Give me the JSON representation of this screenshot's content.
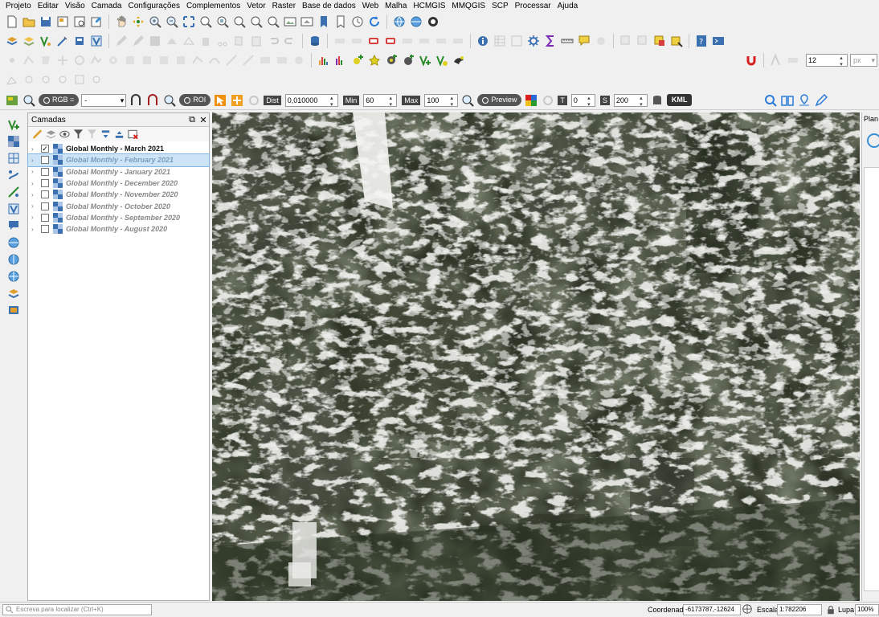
{
  "menubar": {
    "items": [
      "Projeto",
      "Editar",
      "Visão",
      "Camada",
      "Configurações",
      "Complementos",
      "Vetor",
      "Raster",
      "Base de dados",
      "Web",
      "Malha",
      "HCMGIS",
      "MMQGIS",
      "SCP",
      "Processar",
      "Ajuda"
    ]
  },
  "scp_toolbar": {
    "rgb_label": "RGB =",
    "rgb_value": "-",
    "roi_label": "ROI",
    "dist_label": "Dist",
    "dist_value": "0,010000",
    "min_label": "Min",
    "min_value": "60",
    "max_label": "Max",
    "max_value": "100",
    "preview_label": "Preview",
    "t_label": "T",
    "t_value": "0",
    "s_label": "S",
    "s_value": "200",
    "kml_label": "KML"
  },
  "label_toolbar": {
    "font_size": "12",
    "unit": "px"
  },
  "layers_panel": {
    "title": "Camadas",
    "layers": [
      {
        "name": "Global Monthly - March 2021",
        "checked": true,
        "selected": false
      },
      {
        "name": "Global Monthly - February 2021",
        "checked": false,
        "selected": true
      },
      {
        "name": "Global Monthly - January 2021",
        "checked": false,
        "selected": false
      },
      {
        "name": "Global Monthly - December 2020",
        "checked": false,
        "selected": false
      },
      {
        "name": "Global Monthly - November 2020",
        "checked": false,
        "selected": false
      },
      {
        "name": "Global Monthly - October 2020",
        "checked": false,
        "selected": false
      },
      {
        "name": "Global Monthly - September 2020",
        "checked": false,
        "selected": false
      },
      {
        "name": "Global Monthly - August 2020",
        "checked": false,
        "selected": false
      }
    ]
  },
  "right_panel": {
    "title": "Plan"
  },
  "statusbar": {
    "locator_placeholder": "Escreva para localizar (Ctrl+K)",
    "coord_label": "Coordenada",
    "coord_value": "-6173787,-12624",
    "scale_label": "Escala",
    "scale_value": "1:782206",
    "magnifier_label": "Lupa",
    "magnifier_value": "100%"
  },
  "colors": {
    "selection": "#cde4f7",
    "map_vegetation": "#2e3527",
    "cloud": "#f2f2ef"
  }
}
